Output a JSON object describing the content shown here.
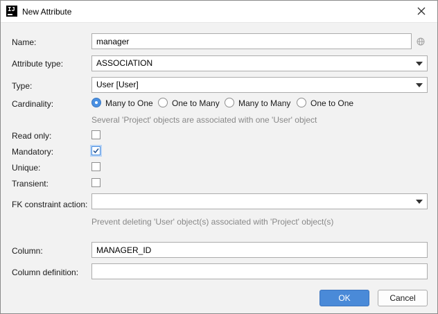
{
  "window": {
    "title": "New Attribute",
    "app_icon_text": "IJ"
  },
  "form": {
    "name": {
      "label": "Name:",
      "value": "manager"
    },
    "attribute_type": {
      "label": "Attribute type:",
      "value": "ASSOCIATION"
    },
    "type": {
      "label": "Type:",
      "value": "User [User]"
    },
    "cardinality": {
      "label": "Cardinality:",
      "options": [
        "Many to One",
        "One to Many",
        "Many to Many",
        "One to One"
      ],
      "selected": "Many to One",
      "hint": "Several 'Project' objects are associated with one 'User' object"
    },
    "read_only": {
      "label": "Read only:",
      "checked": false
    },
    "mandatory": {
      "label": "Mandatory:",
      "checked": true
    },
    "unique": {
      "label": "Unique:",
      "checked": false
    },
    "transient": {
      "label": "Transient:",
      "checked": false
    },
    "fk_constraint": {
      "label": "FK constraint action:",
      "value": "",
      "hint": "Prevent deleting 'User' object(s) associated with 'Project' object(s)"
    },
    "column": {
      "label": "Column:",
      "value": "MANAGER_ID"
    },
    "column_definition": {
      "label": "Column definition:",
      "value": ""
    }
  },
  "buttons": {
    "ok": "OK",
    "cancel": "Cancel"
  },
  "colors": {
    "accent": "#4a8ad8",
    "hint": "#888888",
    "background": "#f2f2f2"
  }
}
